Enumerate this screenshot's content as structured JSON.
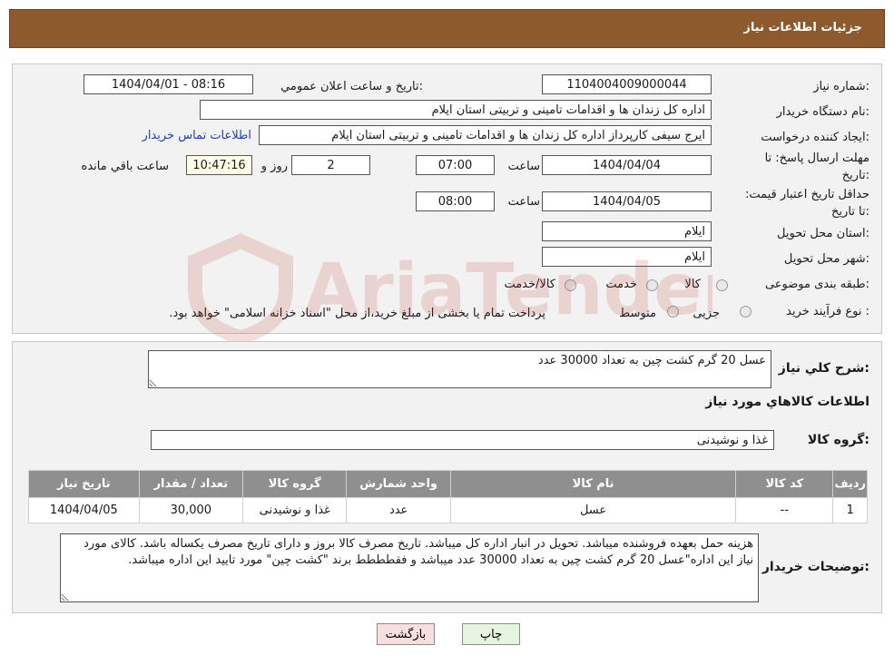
{
  "header": {
    "title": "جزئیات اطلاعات نیاز"
  },
  "form": {
    "need_number_label": "شماره نیاز:",
    "need_number": "1104004009000044",
    "announce_label": "تاریخ و ساعت اعلان عمومي:",
    "announce_value": "1404/04/01 - 08:16",
    "buyer_org_label": "نام دستگاه خریدار:",
    "buyer_org": "اداره کل زندان ها و اقدامات تامینی و تربیتی استان ایلام",
    "creator_label": "ایجاد کننده درخواست:",
    "creator": "ایرج  سیفی کارپرداز اداره کل زندان ها و اقدامات تامینی و تربیتی استان ایلام",
    "contact_link": "اطلاعات تماس خریدار",
    "reply_deadline_label": "مهلت ارسال پاسخ: تا تاریخ:",
    "reply_date": "1404/04/04",
    "time_label": "ساعت",
    "reply_time": "07:00",
    "days_value": "2",
    "days_label": "روز و",
    "remaining_time": "10:47:16",
    "remaining_label": "ساعت باقي مانده",
    "validity_label": "حداقل تاریخ اعتبار قیمت: تا تاریخ:",
    "validity_date": "1404/04/05",
    "validity_time": "08:00",
    "province_label": "استان محل تحویل:",
    "province": "ایلام",
    "city_label": "شهر محل تحویل:",
    "city": "ایلام",
    "category_label": "طبقه بندی موضوعی:",
    "category_options": [
      "کالا",
      "خدمت",
      "کالا/خدمت"
    ],
    "purchase_type_label": "نوع فرآیند خرید :",
    "purchase_options": [
      "جزیی",
      "متوسط"
    ],
    "purchase_note": "پرداخت تمام یا بخشی از مبلغ خرید،از محل \"اسناد خزانه اسلامی\" خواهد بود."
  },
  "details": {
    "summary_label": "شرح کلي نياز:",
    "summary": "عسل 20 گرم کشت چین به تعداد 30000 عدد",
    "goods_info_title": "اطلاعات کالاهاي مورد نياز",
    "goods_group_label": "گروه کالا:",
    "goods_group": "غذا و نوشیدنی",
    "table": {
      "headers": [
        "ردیف",
        "کد کالا",
        "نام کالا",
        "واحد شمارش",
        "گروه کالا",
        "تعداد / مقدار",
        "تاریخ نیاز"
      ],
      "rows": [
        [
          "1",
          "--",
          "عسل",
          "عدد",
          "غذا و نوشیدنی",
          "30,000",
          "1404/04/05"
        ]
      ]
    },
    "buyer_notes_label": "توضیحات خریدار:",
    "buyer_notes": "هزینه حمل بعهده فروشنده میباشد. تحویل در انبار اداره کل میباشد. تاریخ مصرف کالا بروز و دارای تاریخ مصرف یکساله باشد. کالای مورد نیاز این اداره\"عسل 20 گرم کشت چین به تعداد 30000 عدد میباشد و فقطططط برند \"کشت چین\" مورد تایید این اداره میباشد."
  },
  "buttons": {
    "print": "چاپ",
    "back": "بازگشت"
  },
  "watermark": {
    "text": "AriaTender.neT"
  },
  "colors": {
    "header_bg": "#8d5a2e",
    "panel_bg": "#f2f2f2",
    "table_header_bg": "#8f8f8f",
    "print_btn_bg": "#e6f5e0",
    "back_btn_bg": "#f9dede",
    "link": "#1a3fcc",
    "watermark": "#c0392b"
  }
}
